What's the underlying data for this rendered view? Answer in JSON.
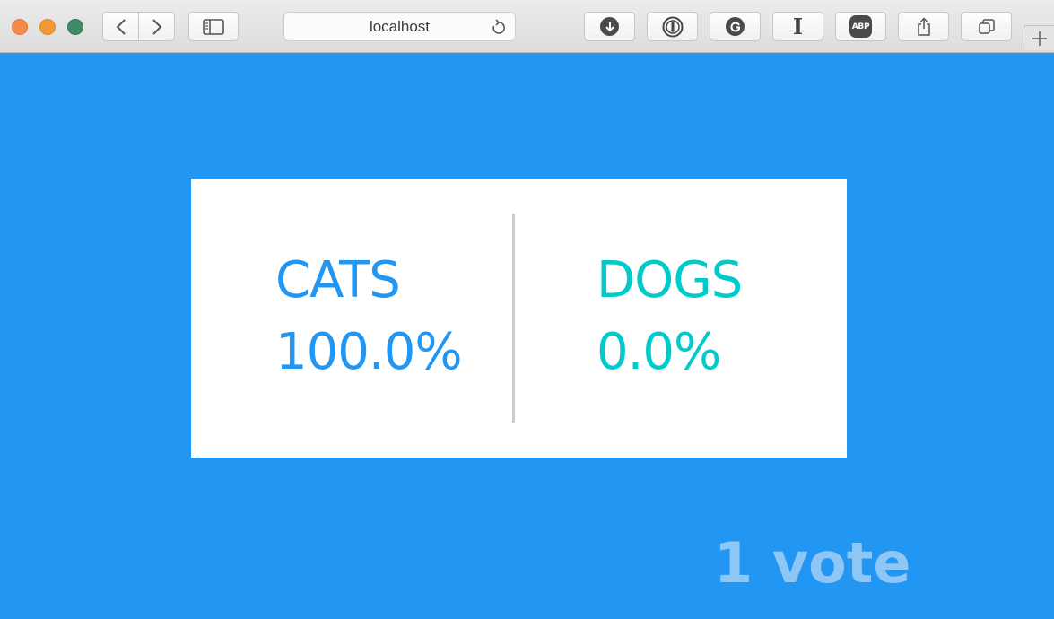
{
  "browser": {
    "url": "localhost",
    "colors": {
      "close": "#f68a4a",
      "minimize": "#f19a35",
      "zoom": "#3f8a68"
    },
    "toolbar_icons": [
      "back-icon",
      "forward-icon",
      "sidebar-icon",
      "reload-icon",
      "download-icon",
      "1password-icon",
      "grammarly-icon",
      "instapaper-icon",
      "adblock-plus-icon",
      "share-icon",
      "tabs-overview-icon",
      "new-tab-icon"
    ],
    "abp_label": "ABP",
    "instapaper_label": "I"
  },
  "results": {
    "background_color": "#2196f3",
    "choice_a": {
      "label": "CATS",
      "percent": "100.0%",
      "color": "#2196f3"
    },
    "choice_b": {
      "label": "DOGS",
      "percent": "0.0%",
      "color": "#00cbca"
    },
    "vote_count": "1 vote",
    "vote_count_color": "#8ec6f5"
  }
}
